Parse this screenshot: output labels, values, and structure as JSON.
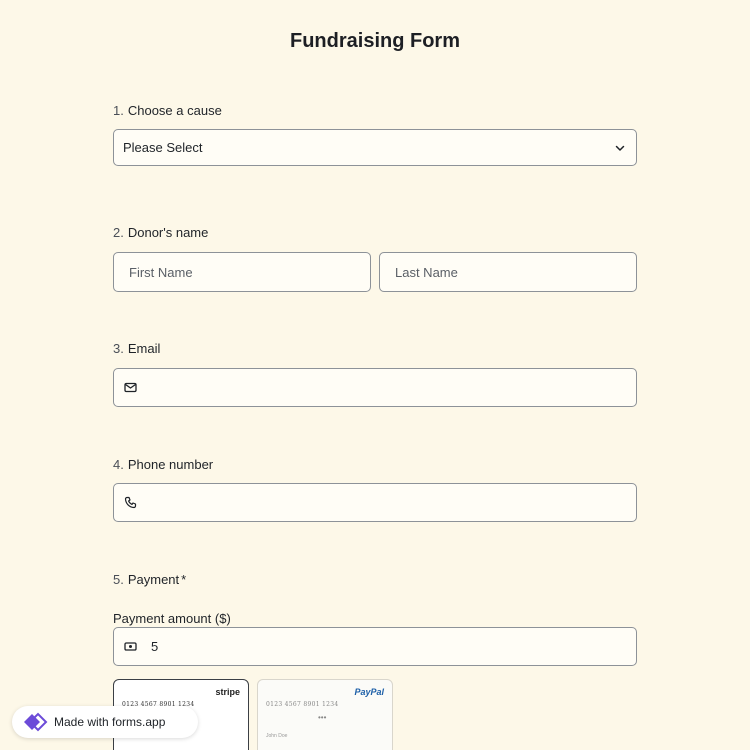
{
  "form": {
    "title": "Fundraising Form"
  },
  "questions": {
    "cause": {
      "number": "1.",
      "label": "Choose a cause",
      "selected": "Please Select"
    },
    "name": {
      "number": "2.",
      "label": "Donor's name",
      "first_placeholder": "First Name",
      "last_placeholder": "Last Name"
    },
    "email": {
      "number": "3.",
      "label": "Email",
      "icon": "envelope-icon"
    },
    "phone": {
      "number": "4.",
      "label": "Phone number",
      "icon": "phone-icon"
    },
    "payment": {
      "number": "5.",
      "label": "Payment",
      "required_mark": "*",
      "amount_label": "Payment amount ($)",
      "amount_value": "5",
      "icon": "cash-icon"
    }
  },
  "payment_options": [
    {
      "brand": "stripe",
      "card_number": "0123 4567 8901 1234",
      "dots": "•••",
      "selected": true
    },
    {
      "brand": "PayPal",
      "card_number": "0123 4567 8901 1234",
      "dots": "•••",
      "card_name": "John Doe",
      "selected": false
    }
  ],
  "footer_badge": {
    "text": "Made with forms.app"
  },
  "colors": {
    "background": "#fdf8e8",
    "field_border": "#8d9298",
    "logo_accent": "#6c4bd8"
  }
}
